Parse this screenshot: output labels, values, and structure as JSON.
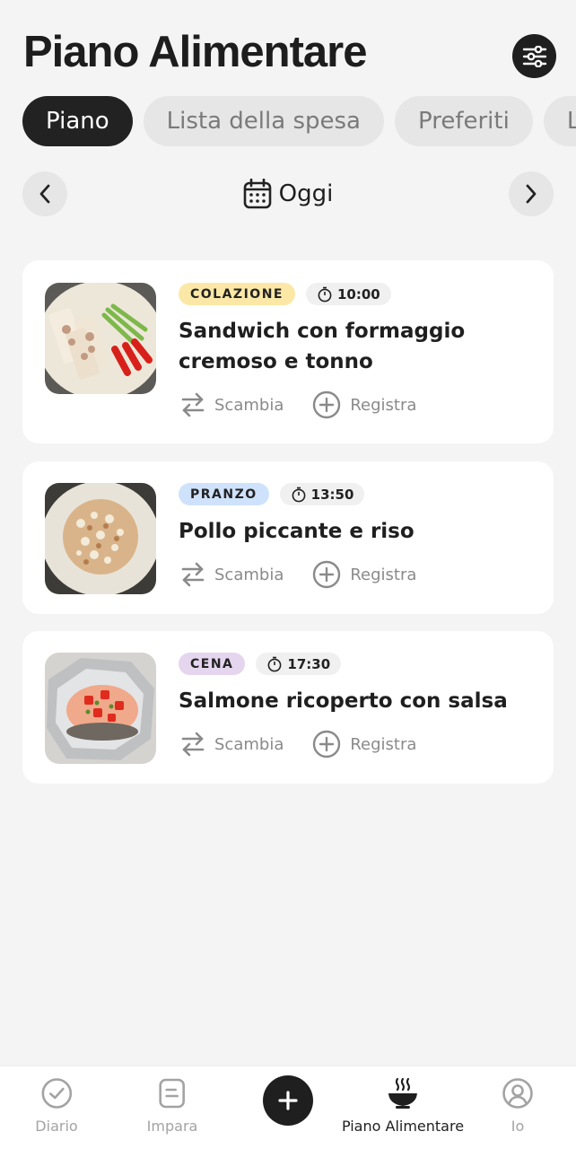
{
  "header": {
    "title": "Piano Alimentare"
  },
  "tabs": [
    "Piano",
    "Lista della spesa",
    "Preferiti",
    "L"
  ],
  "date_nav": {
    "label": "Oggi"
  },
  "meals": [
    {
      "type": "COLAZIONE",
      "time": "10:00",
      "name": "Sandwich con formaggio cremoso e tonno",
      "badge_color": "#fbe8a6",
      "swap_label": "Scambia",
      "log_label": "Registra"
    },
    {
      "type": "PRANZO",
      "time": "13:50",
      "name": "Pollo piccante e riso",
      "badge_color": "#cfe2fb",
      "swap_label": "Scambia",
      "log_label": "Registra"
    },
    {
      "type": "CENA",
      "time": "17:30",
      "name": "Salmone ricoperto con salsa",
      "badge_color": "#e5d5ee",
      "swap_label": "Scambia",
      "log_label": "Registra"
    }
  ],
  "bottom_nav": {
    "items": [
      {
        "label": "Diario",
        "icon": "check-circle-icon"
      },
      {
        "label": "Impara",
        "icon": "document-icon"
      },
      {
        "label": "Piano Alimentare",
        "icon": "bowl-icon",
        "active": true
      },
      {
        "label": "Io",
        "icon": "user-circle-icon"
      }
    ]
  }
}
